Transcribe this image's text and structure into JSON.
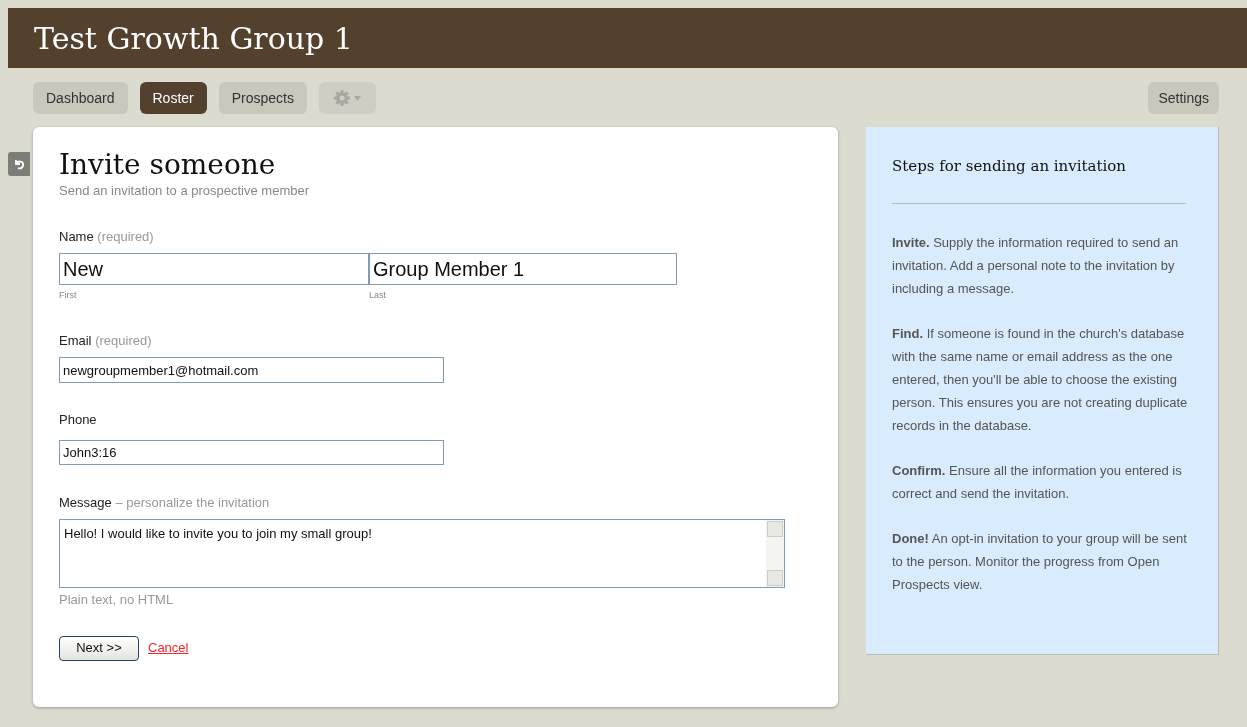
{
  "header": {
    "title": "Test Growth Group 1"
  },
  "tabs": [
    {
      "label": "Dashboard",
      "selected": false
    },
    {
      "label": "Roster",
      "selected": true
    },
    {
      "label": "Prospects",
      "selected": false
    }
  ],
  "settings_button": "Settings",
  "form": {
    "title": "Invite someone",
    "subtitle": "Send an invitation to a prospective member",
    "name": {
      "label": "Name",
      "note": "(required)",
      "first": {
        "value": "New",
        "caption": "First"
      },
      "last": {
        "value": "Group Member 1",
        "caption": "Last"
      }
    },
    "email": {
      "label": "Email",
      "note": "(required)",
      "value": "newgroupmember1@hotmail.com"
    },
    "phone": {
      "label": "Phone",
      "value": "John3:16"
    },
    "message": {
      "label": "Message",
      "note": "– personalize the invitation",
      "value": "Hello! I would like to invite you to join my small group!",
      "hint": "Plain text, no HTML"
    },
    "next_button": "Next >>",
    "cancel_link": "Cancel"
  },
  "steps_panel": {
    "title": "Steps for sending an invitation",
    "steps": [
      "**Invite.** Supply the information required to send an invitation. Add a personal note to the invitation by including a message.",
      "**Find.** If someone is found in the church's database with the same name or email address as the one entered, then you'll be able to choose the existing person. This ensures you are not creating duplicate records in the database.",
      "**Confirm.** Ensure all the information you entered is correct and send the invitation.",
      "**Done!** An opt-in invitation to your group will be sent to the person. Monitor the progress from Open Prospects view."
    ]
  }
}
